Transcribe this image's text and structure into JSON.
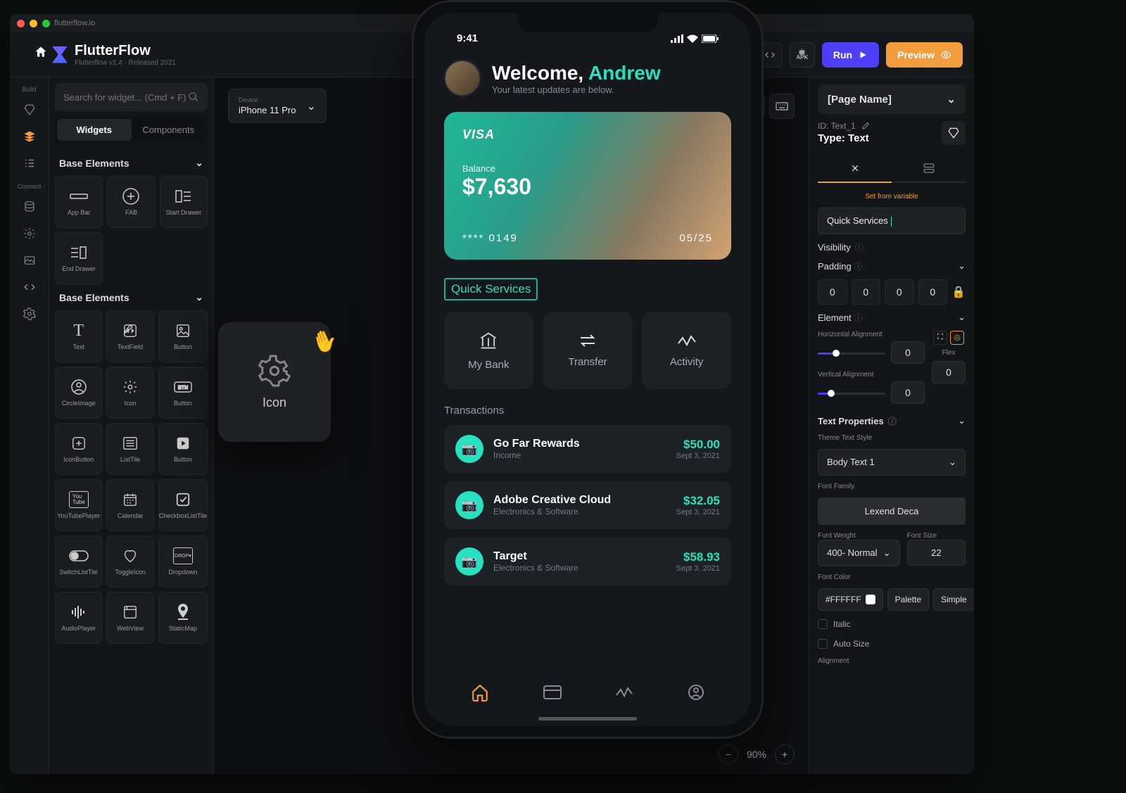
{
  "window": {
    "url": "flutterflow.io"
  },
  "brand": {
    "name": "FlutterFlow",
    "subtitle": "Flutterflow v1.4 - Released 2021"
  },
  "topbar": {
    "run": "Run",
    "preview": "Preview"
  },
  "leftrail": {
    "sections": [
      "Build",
      "Connect"
    ]
  },
  "widgets_panel": {
    "search_placeholder": "Search for widget... (Cmd + F)",
    "tabs": {
      "widgets": "Widgets",
      "components": "Components"
    },
    "group1": "Base Elements",
    "group2": "Base Elements",
    "items1": [
      "App Bar",
      "FAB",
      "Start Drawer",
      "End Drawer"
    ],
    "items2": [
      "Text",
      "TextField",
      "Button",
      "CircleImage",
      "Icon",
      "Button",
      "IconButton",
      "ListTile",
      "Button",
      "YouTubePlayer",
      "Calendar",
      "CheckboxListTile",
      "SwitchListTile",
      "ToggleIcon",
      "Dropdown",
      "AudioPlayer",
      "WebView",
      "StaticMap"
    ]
  },
  "canvas": {
    "device_label": "Device",
    "device_value": "iPhone 11 Pro",
    "drag_widget": "Icon",
    "zoom": "90%"
  },
  "props": {
    "page_name": "[Page Name]",
    "id_label": "ID: Text_1",
    "type_label": "Type: Text",
    "set_from_var": "Set from variable",
    "text_value": "Quick Services",
    "visibility": "Visibility",
    "padding": "Padding",
    "pad": [
      "0",
      "0",
      "0",
      "0"
    ],
    "element": "Element",
    "h_align": "Horizontal Alignment",
    "v_align": "Vertical Alignment",
    "flex_label": "Flex",
    "align_val": "0",
    "flex_val": "0",
    "text_properties": "Text Properties",
    "theme_style": "Theme Text Style",
    "style_val": "Body Text 1",
    "font_family": "Font Family",
    "font_family_val": "Lexend Deca",
    "font_weight": "Font Weight",
    "font_weight_val": "400- Normal",
    "font_size": "Font Size",
    "font_size_val": "22",
    "font_color": "Font Color",
    "font_color_val": "#FFFFFF",
    "palette": "Palette",
    "simple": "Simple",
    "italic": "Italic",
    "autosize": "Auto Size",
    "alignment": "Alignment"
  },
  "phone": {
    "time": "9:41",
    "welcome": "Welcome,",
    "name": "Andrew",
    "subtitle": "Your latest updates are below.",
    "card": {
      "brand": "VISA",
      "balance_label": "Balance",
      "balance": "$7,630",
      "masked": "****  0149",
      "exp": "05/25"
    },
    "quick_services": "Quick Services",
    "services": [
      {
        "icon": "bank",
        "label": "My Bank"
      },
      {
        "icon": "transfer",
        "label": "Transfer"
      },
      {
        "icon": "activity",
        "label": "Activity"
      }
    ],
    "transactions_h": "Transactions",
    "transactions": [
      {
        "title": "Go Far Rewards",
        "cat": "Income",
        "amount": "$50.00",
        "date": "Sept 3, 2021"
      },
      {
        "title": "Adobe Creative Cloud",
        "cat": "Electronics & Software",
        "amount": "$32.05",
        "date": "Sept 3, 2021"
      },
      {
        "title": "Target",
        "cat": "Electronics & Software",
        "amount": "$58.93",
        "date": "Sept 3, 2021"
      }
    ]
  }
}
